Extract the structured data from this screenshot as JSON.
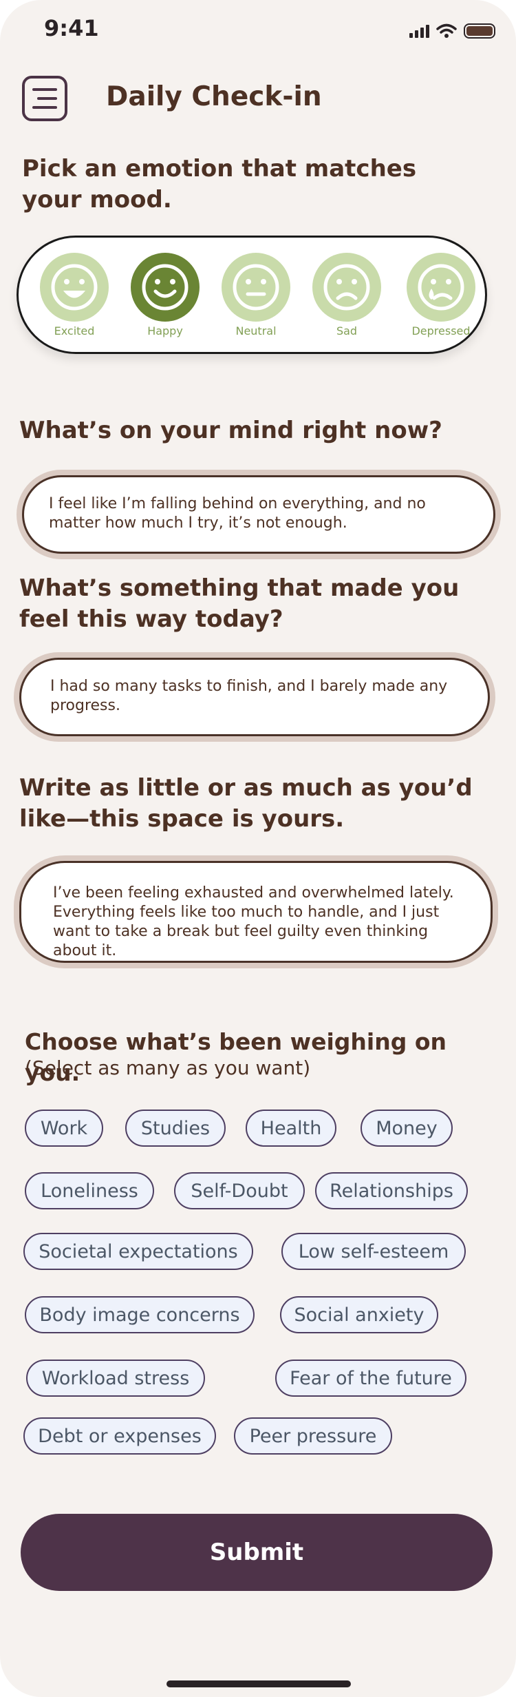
{
  "status_bar": {
    "time": "9:41"
  },
  "header": {
    "title": "Daily Check-in"
  },
  "mood": {
    "question": "Pick an emotion that matches your mood.",
    "options": [
      {
        "label": "Excited",
        "icon": "grinning-face-icon"
      },
      {
        "label": "Happy",
        "icon": "smiling-face-icon",
        "selected": true
      },
      {
        "label": "Neutral",
        "icon": "neutral-face-icon"
      },
      {
        "label": "Sad",
        "icon": "sad-face-icon"
      },
      {
        "label": "Depressed",
        "icon": "crying-face-icon"
      }
    ],
    "selected": "Happy"
  },
  "questions": [
    {
      "question": "What’s on your mind right now?",
      "answer": "I feel like I’m falling behind on everything, and no matter how much I try, it’s not enough."
    },
    {
      "question": "What’s something that made you feel this way today?",
      "answer": "I had so many tasks to finish, and I barely made any progress."
    },
    {
      "question": "Write as little or as much as you’d like—this space is yours.",
      "answer": "I’ve been feeling exhausted and overwhelmed lately. Everything feels like too much to handle, and I just want to take a break but feel guilty even thinking about it."
    }
  ],
  "concerns": {
    "question": "Choose what’s been weighing on you.",
    "subtitle": "(Select as many as you want)",
    "chips": [
      "Work",
      "Studies",
      "Health",
      "Money",
      "Loneliness",
      "Self-Doubt",
      "Relationships",
      "Societal expectations",
      "Low self-esteem",
      "Body image concerns",
      "Social anxiety",
      "Workload stress",
      "Fear of the future",
      "Debt or expenses",
      "Peer pressure"
    ]
  },
  "submit_label": "Submit",
  "colors": {
    "background": "#f6f2ef",
    "heading": "#4d3124",
    "accent_dark": "#4e3349",
    "mood_selected": "#6a8534",
    "mood_default": "#c9dbaa",
    "chip_bg": "#eef2fb"
  }
}
